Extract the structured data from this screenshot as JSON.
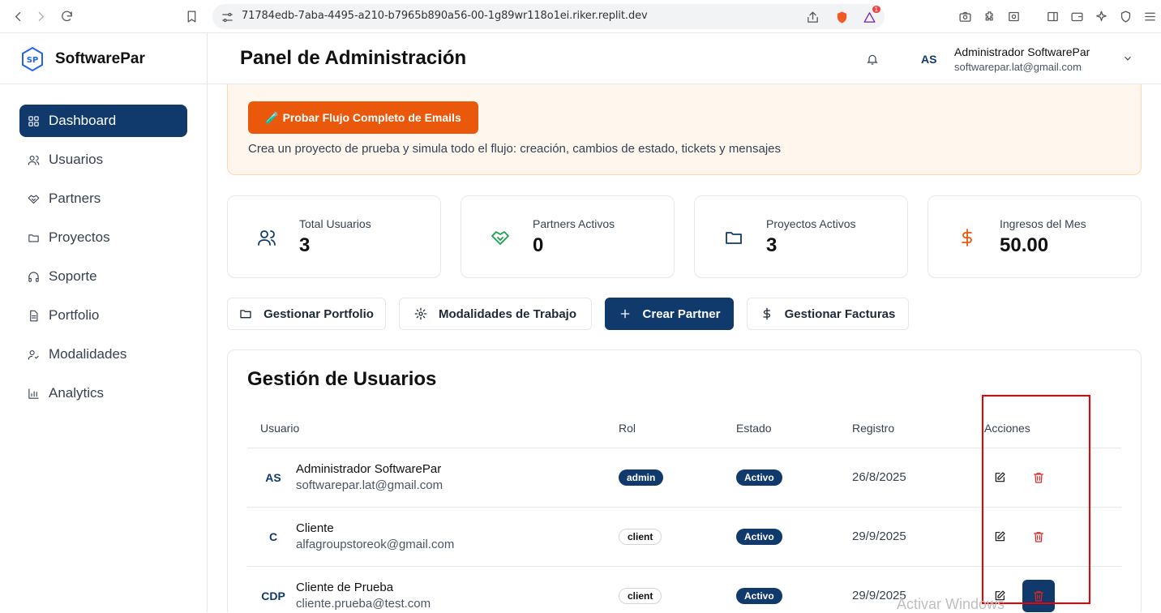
{
  "browser": {
    "url": "71784edb-7aba-4495-a210-b7965b890a56-00-1g89wr118o1ei.riker.replit.dev",
    "notification_count": "1"
  },
  "sidebar": {
    "brand": "SoftwarePar",
    "items": [
      {
        "label": "Dashboard",
        "icon": "grid-icon"
      },
      {
        "label": "Usuarios",
        "icon": "users-icon"
      },
      {
        "label": "Partners",
        "icon": "handshake-icon"
      },
      {
        "label": "Proyectos",
        "icon": "folder-icon"
      },
      {
        "label": "Soporte",
        "icon": "headphones-icon"
      },
      {
        "label": "Portfolio",
        "icon": "file-icon"
      },
      {
        "label": "Modalidades",
        "icon": "user-check-icon"
      },
      {
        "label": "Analytics",
        "icon": "bar-chart-icon"
      }
    ]
  },
  "header": {
    "title": "Panel de Administración",
    "avatar": "AS",
    "user_name": "Administrador SoftwarePar",
    "user_email": "softwarepar.lat@gmail.com"
  },
  "promo": {
    "button": "🧪 Probar Flujo Completo de Emails",
    "description": "Crea un proyecto de prueba y simula todo el flujo: creación, cambios de estado, tickets y mensajes"
  },
  "stats": [
    {
      "label": "Total Usuarios",
      "value": "3",
      "color": "#0f3a6b"
    },
    {
      "label": "Partners Activos",
      "value": "0",
      "color": "#16a34a"
    },
    {
      "label": "Proyectos Activos",
      "value": "3",
      "color": "#0f3a6b"
    },
    {
      "label": "Ingresos del Mes",
      "value": "50.00",
      "color": "#ea580c"
    }
  ],
  "actions": [
    {
      "label": "Gestionar Portfolio"
    },
    {
      "label": "Modalidades de Trabajo"
    },
    {
      "label": "Crear Partner"
    },
    {
      "label": "Gestionar Facturas"
    }
  ],
  "users_table": {
    "title": "Gestión de Usuarios",
    "columns": [
      "Usuario",
      "Rol",
      "Estado",
      "Registro",
      "Acciones"
    ],
    "rows": [
      {
        "avatar": "AS",
        "name": "Administrador SoftwarePar",
        "email": "softwarepar.lat@gmail.com",
        "role": "admin",
        "status": "Activo",
        "date": "26/8/2025"
      },
      {
        "avatar": "C",
        "name": "Cliente",
        "email": "alfagroupstoreok@gmail.com",
        "role": "client",
        "status": "Activo",
        "date": "29/9/2025"
      },
      {
        "avatar": "CDP",
        "name": "Cliente de Prueba",
        "email": "cliente.prueba@test.com",
        "role": "client",
        "status": "Activo",
        "date": "29/9/2025"
      }
    ]
  },
  "overlay": {
    "watermark": "Activar Windows"
  }
}
